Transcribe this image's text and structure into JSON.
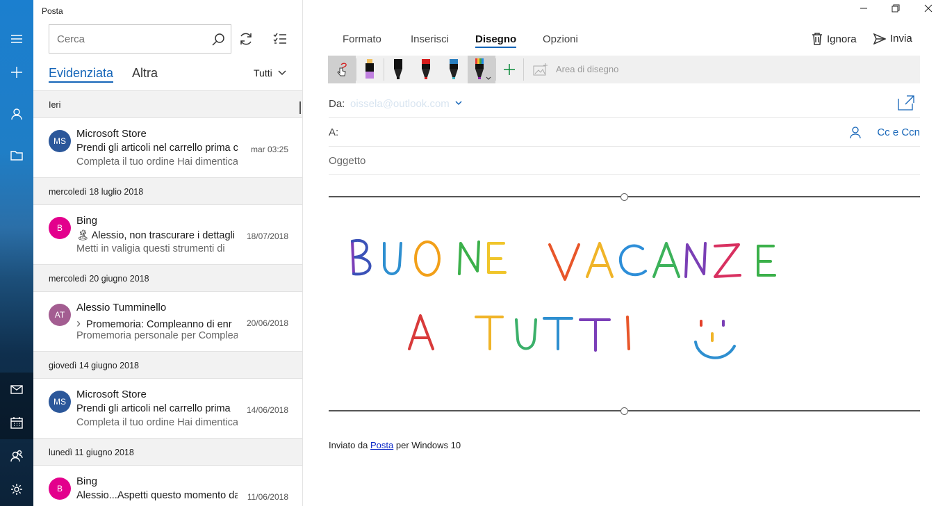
{
  "app": {
    "title": "Posta"
  },
  "rail": {
    "items": [
      "menu-icon",
      "new-mail-icon",
      "account-icon",
      "folder-icon",
      "mail-icon",
      "calendar-icon",
      "people-icon",
      "settings-icon"
    ],
    "active": "mail-icon"
  },
  "list": {
    "search_placeholder": "Cerca",
    "tabs": {
      "focused": "Evidenziata",
      "other": "Altra"
    },
    "filter": "Tutti",
    "groups": [
      {
        "heading": "Ieri",
        "messages": [
          {
            "initials": "MS",
            "avatar_color": "#2b579a",
            "sender": "Microsoft Store",
            "subject": "Prendi gli articoli nel carrello prima che",
            "preview": "Completa il tuo ordine Hai dimenticato",
            "date": "mar 03:25"
          }
        ]
      },
      {
        "heading": "mercoledì 18 luglio 2018",
        "messages": [
          {
            "initials": "B",
            "avatar_color": "#e3008c",
            "sender": "Bing",
            "subject": "🏝 Alessio, non trascurare i dettagli",
            "preview": "Metti in valigia questi strumenti di",
            "date": "18/07/2018"
          }
        ]
      },
      {
        "heading": "mercoledì 20 giugno 2018",
        "messages": [
          {
            "initials": "AT",
            "avatar_color": "#a35d91",
            "sender": "Alessio Tumminello",
            "subject": "Promemoria: Compleanno di enr",
            "preview": "Promemoria personale per Compleanno",
            "date": "20/06/2018",
            "has_chevron": true
          }
        ]
      },
      {
        "heading": "giovedì 14 giugno 2018",
        "messages": [
          {
            "initials": "MS",
            "avatar_color": "#2b579a",
            "sender": "Microsoft Store",
            "subject": "Prendi gli articoli nel carrello prima",
            "preview": "Completa il tuo ordine Hai dimenticato",
            "date": "14/06/2018"
          }
        ]
      },
      {
        "heading": "lunedì 11 giugno 2018",
        "messages": [
          {
            "initials": "B",
            "avatar_color": "#e3008c",
            "sender": "Bing",
            "subject": "Alessio...Aspetti questo momento da",
            "preview": "",
            "date": "11/06/2018"
          }
        ]
      }
    ]
  },
  "compose": {
    "ribbon_tabs": [
      "Formato",
      "Inserisci",
      "Disegno",
      "Opzioni"
    ],
    "active_tab": "Disegno",
    "discard_label": "Ignora",
    "send_label": "Invia",
    "canvas_label": "Area di disegno",
    "from_label": "Da:",
    "from_value": "oissela@outlook.com",
    "to_label": "A:",
    "cc_label": "Cc e Ccn",
    "subject_placeholder": "Oggetto",
    "signature": {
      "prefix": "Inviato da ",
      "link": "Posta",
      "suffix": " per Windows 10"
    },
    "ink_colors": {
      "pen_black": "#111111",
      "pen_red": "#d51c1c",
      "pen_galaxy": "#2a7fc0",
      "highlighter": "#b05fd0",
      "add": "#0a8a3a",
      "accent": "#1565b8"
    }
  }
}
